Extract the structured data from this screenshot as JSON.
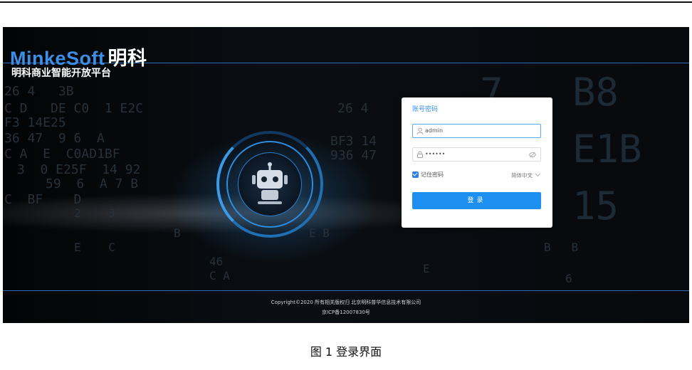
{
  "brand": {
    "name_en": "MinkeSoft",
    "name_cn": "明科"
  },
  "platform_title": "明科商业智能开放平台",
  "login": {
    "tab_label": "账号密码",
    "username_value": "admin",
    "password_value": "••••••",
    "remember_label": "记住密码",
    "remember_checked": true,
    "language": "简体中文",
    "submit_label": "登录"
  },
  "footer": {
    "copyright": "Copyright©2020   所有相关版权归   北京明科普华信息技术有限公司",
    "icp": "京ICP备12007830号"
  },
  "caption": "图 1  登录界面",
  "colors": {
    "accent": "#1c8ff0",
    "brand_blue": "#3d8ee6",
    "background": "#050608"
  },
  "icons": [
    "user-icon",
    "lock-icon",
    "eye-off-icon",
    "checkbox-icon",
    "chevron-down-icon",
    "robot-icon"
  ]
}
